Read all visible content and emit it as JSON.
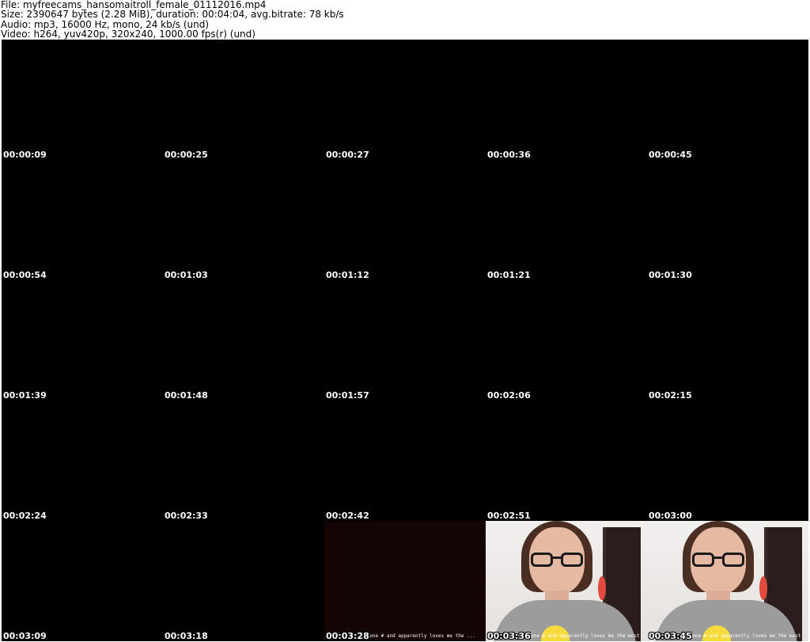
{
  "header": {
    "file": "File: myfreecams_hansomaitroll_female_01112016.mp4",
    "size": "Size: 2390647 bytes (2.28 MiB), duration: 00:04:04, avg.bitrate: 78 kb/s",
    "audio": "Audio: mp3, 16000 Hz, mono, 24 kb/s (und)",
    "video": "Video: h264, yuv420p, 320x240, 1000.00 fps(r) (und)"
  },
  "thumbnails": [
    {
      "time": "00:00:09",
      "kind": "black"
    },
    {
      "time": "00:00:25",
      "kind": "black"
    },
    {
      "time": "00:00:27",
      "kind": "black"
    },
    {
      "time": "00:00:36",
      "kind": "black"
    },
    {
      "time": "00:00:45",
      "kind": "black"
    },
    {
      "time": "00:00:54",
      "kind": "black"
    },
    {
      "time": "00:01:03",
      "kind": "black"
    },
    {
      "time": "00:01:12",
      "kind": "black"
    },
    {
      "time": "00:01:21",
      "kind": "black"
    },
    {
      "time": "00:01:30",
      "kind": "black"
    },
    {
      "time": "00:01:39",
      "kind": "black"
    },
    {
      "time": "00:01:48",
      "kind": "black"
    },
    {
      "time": "00:01:57",
      "kind": "black"
    },
    {
      "time": "00:02:06",
      "kind": "black"
    },
    {
      "time": "00:02:15",
      "kind": "black"
    },
    {
      "time": "00:02:24",
      "kind": "black"
    },
    {
      "time": "00:02:33",
      "kind": "black"
    },
    {
      "time": "00:02:42",
      "kind": "black"
    },
    {
      "time": "00:02:51",
      "kind": "black"
    },
    {
      "time": "00:03:00",
      "kind": "black"
    },
    {
      "time": "00:03:09",
      "kind": "black"
    },
    {
      "time": "00:03:18",
      "kind": "black"
    },
    {
      "time": "00:03:28",
      "kind": "dark-red",
      "caption": "Phone # and apparently loves me the ..."
    },
    {
      "time": "00:03:36",
      "kind": "person",
      "caption": "Phone # and apparently loves me the most"
    },
    {
      "time": "00:03:45",
      "kind": "person",
      "caption": "Phone # and apparently loves me the most"
    }
  ]
}
